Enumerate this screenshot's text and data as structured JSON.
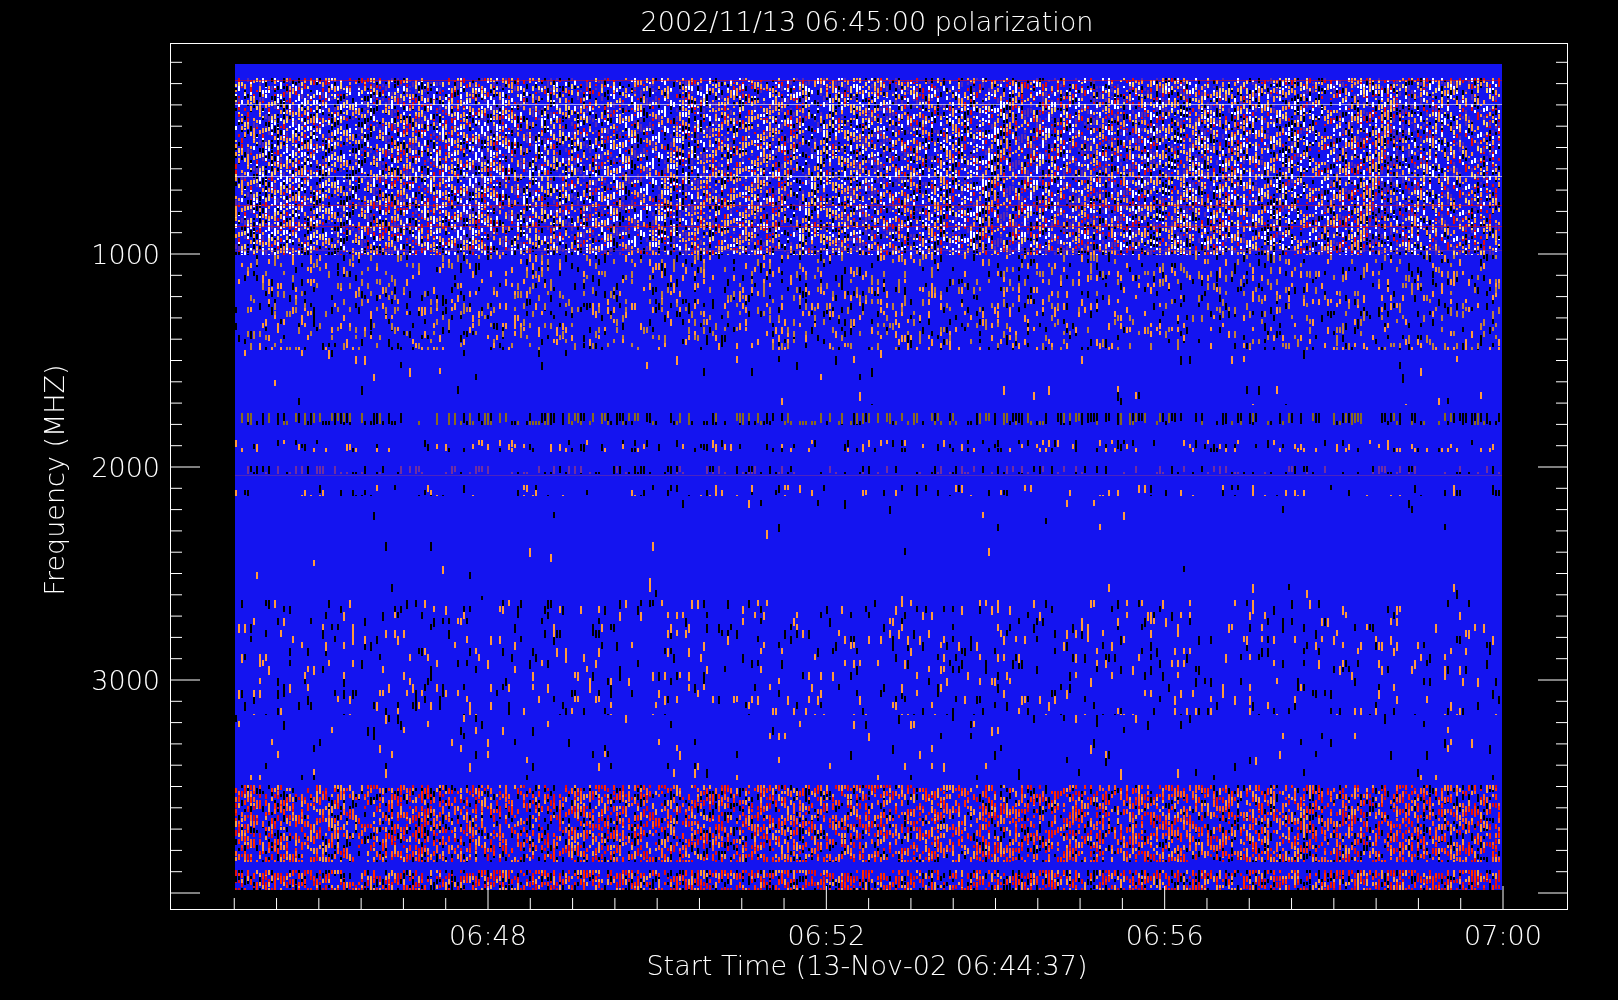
{
  "title": "2002/11/13 06:45:00 polarization",
  "y_axis": {
    "label": "Frequency (MHZ)",
    "tick_labels": [
      "1000",
      "2000",
      "3000"
    ]
  },
  "x_axis": {
    "label": "Start Time (13-Nov-02 06:44:37)",
    "tick_labels": [
      "06:48",
      "06:52",
      "06:56",
      "07:00"
    ]
  }
}
